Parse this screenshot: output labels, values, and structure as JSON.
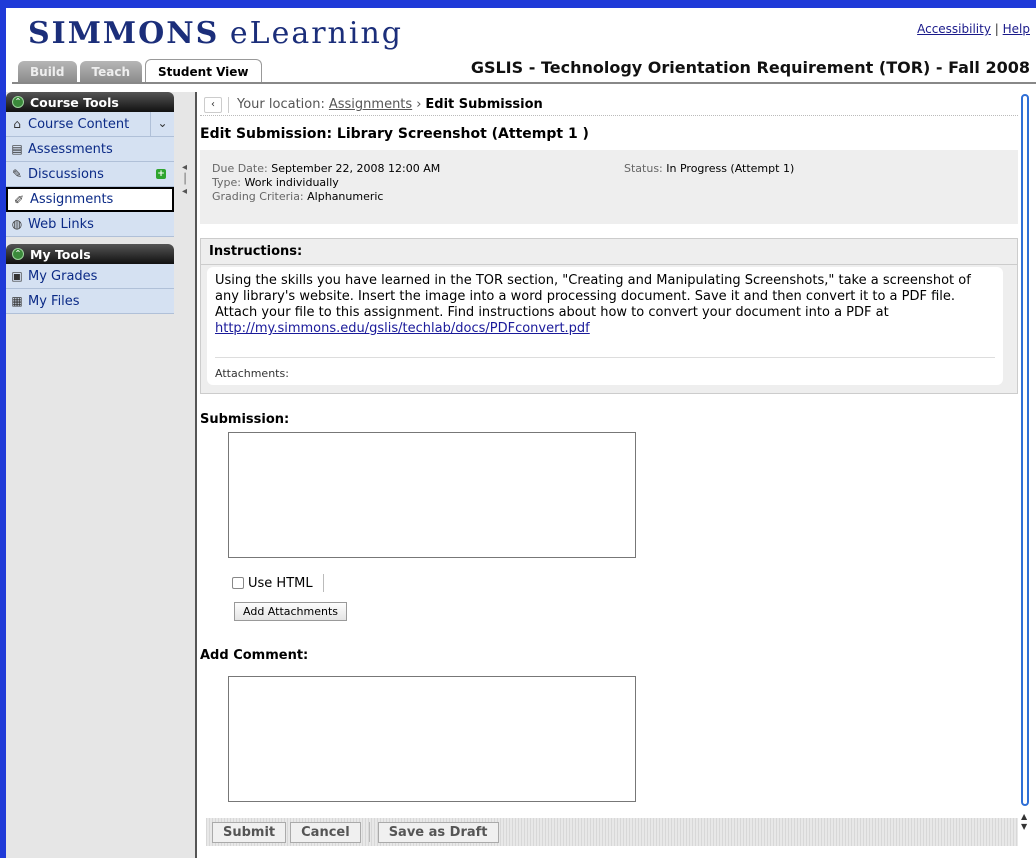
{
  "header": {
    "logo_bold": "SIMMONS",
    "logo_light": "eLearning",
    "accessibility_link": "Accessibility",
    "link_separator": "|",
    "help_link": "Help",
    "course_title": "GSLIS - Technology Orientation Requirement (TOR) - Fall 2008"
  },
  "tabs": [
    {
      "label": "Build"
    },
    {
      "label": "Teach"
    },
    {
      "label": "Student View"
    }
  ],
  "sidebar": {
    "course_tools_title": "Course Tools",
    "course_tools": [
      {
        "label": "Course Content"
      },
      {
        "label": "Assessments"
      },
      {
        "label": "Discussions"
      },
      {
        "label": "Assignments"
      },
      {
        "label": "Web Links"
      }
    ],
    "my_tools_title": "My Tools",
    "my_tools": [
      {
        "label": "My Grades"
      },
      {
        "label": "My Files"
      }
    ]
  },
  "breadcrumb": {
    "prefix": "Your location:",
    "link": "Assignments",
    "arrow": "›",
    "current": "Edit Submission"
  },
  "page_title": "Edit Submission: Library Screenshot (Attempt 1 )",
  "info": {
    "due_label": "Due Date:",
    "due_value": "September 22, 2008 12:00 AM",
    "type_label": "Type:",
    "type_value": "Work individually",
    "grading_label": "Grading Criteria:",
    "grading_value": "Alphanumeric",
    "status_label": "Status:",
    "status_value": "In Progress (Attempt 1)"
  },
  "instructions": {
    "title": "Instructions:",
    "text": "Using the skills you have learned in the TOR section, \"Creating and Manipulating Screenshots,\" take a screenshot of any library's website. Insert the image into a word processing document. Save it and then convert it to a PDF file. Attach your file to this assignment. Find instructions about how to convert your document into a PDF at",
    "link": "http://my.simmons.edu/gslis/techlab/docs/PDFconvert.pdf",
    "attachments_label": "Attachments:"
  },
  "submission": {
    "label": "Submission:",
    "use_html": "Use HTML",
    "add_attachments": "Add Attachments"
  },
  "comment": {
    "label": "Add Comment:"
  },
  "actions": {
    "submit": "Submit",
    "cancel": "Cancel",
    "save_draft": "Save as Draft"
  }
}
